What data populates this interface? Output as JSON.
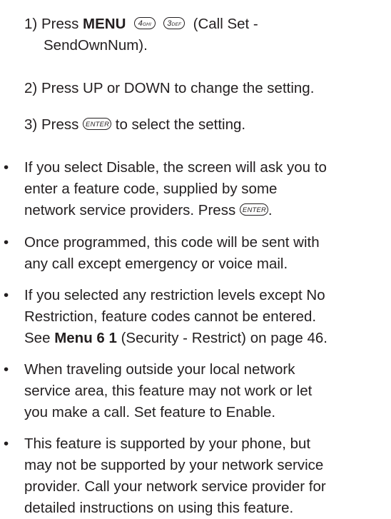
{
  "steps": [
    {
      "num": "1)",
      "pre": "Press",
      "menu": "MENU",
      "key1_digit": "4",
      "key1_letters": "GHI",
      "key2_digit": "3",
      "key2_letters": "DEF",
      "post": "(Call Set -",
      "line2": "SendOwnNum)."
    },
    {
      "num": "2)",
      "text": "Press UP or DOWN to change the setting."
    },
    {
      "num": "3)",
      "pre": "Press",
      "enter_key": "ENTER",
      "post": "to select the setting."
    }
  ],
  "bullet_char": "•",
  "bullets": [
    {
      "lines": [
        "If you select Disable, the screen will ask you to",
        "enter a feature code, supplied by some"
      ],
      "last_pre": "network service providers. Press",
      "enter_key": "ENTER",
      "last_post": "."
    },
    {
      "lines": [
        "Once programmed, this code will be sent with",
        "any call except emergency or voice mail."
      ]
    },
    {
      "lines": [
        "If you selected any restriction levels except No",
        "Restriction, feature codes cannot be entered."
      ],
      "last_pre": "See",
      "menu_ref": "Menu 6 1",
      "last_post": "(Security - Restrict) on page 46."
    },
    {
      "lines": [
        "When traveling outside your local network",
        "service area, this feature may not work or let",
        "you make a call. Set feature to Enable."
      ]
    },
    {
      "lines": [
        "This feature is supported by your phone, but",
        "may not be supported by your network service",
        "provider. Call your network service provider for",
        "detailed instructions on using this feature."
      ]
    }
  ]
}
